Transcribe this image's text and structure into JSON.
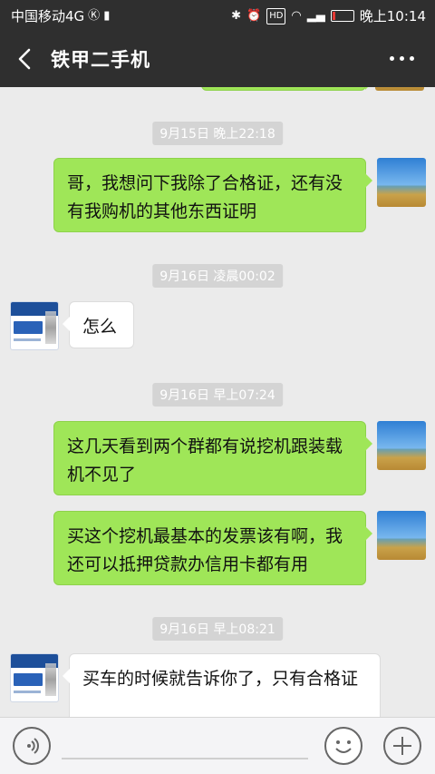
{
  "status_bar": {
    "carrier": "中国移动4G",
    "time": "晚上10:14",
    "icons": [
      "bluetooth-icon",
      "alarm-icon",
      "hd-icon",
      "wifi-icon",
      "signal-4g-icon",
      "battery-icon"
    ],
    "battery_level": 0.15
  },
  "header": {
    "title": "铁甲二手机"
  },
  "messages": [
    {
      "type": "timestamp",
      "text": "9月15日 晚上22:18"
    },
    {
      "type": "bubble",
      "sender": "me",
      "text": "哥，我想问下我除了合格证，还有没有我购机的其他东西证明"
    },
    {
      "type": "timestamp",
      "text": "9月16日 凌晨00:02"
    },
    {
      "type": "bubble",
      "sender": "other",
      "text": "怎么"
    },
    {
      "type": "timestamp",
      "text": "9月16日 早上07:24"
    },
    {
      "type": "bubble",
      "sender": "me",
      "text": "这几天看到两个群都有说挖机跟装载机不见了"
    },
    {
      "type": "bubble",
      "sender": "me",
      "text": "买这个挖机最基本的发票该有啊，我还可以抵押贷款办信用卡都有用"
    },
    {
      "type": "timestamp",
      "text": "9月16日 早上08:21"
    },
    {
      "type": "bubble",
      "sender": "other",
      "text": "买车的时候就告诉你了，只有合格证"
    }
  ],
  "colors": {
    "bar_bg": "#2f2f2f",
    "chat_bg": "#ebebeb",
    "my_bubble": "#9fe658",
    "other_bubble": "#ffffff"
  }
}
